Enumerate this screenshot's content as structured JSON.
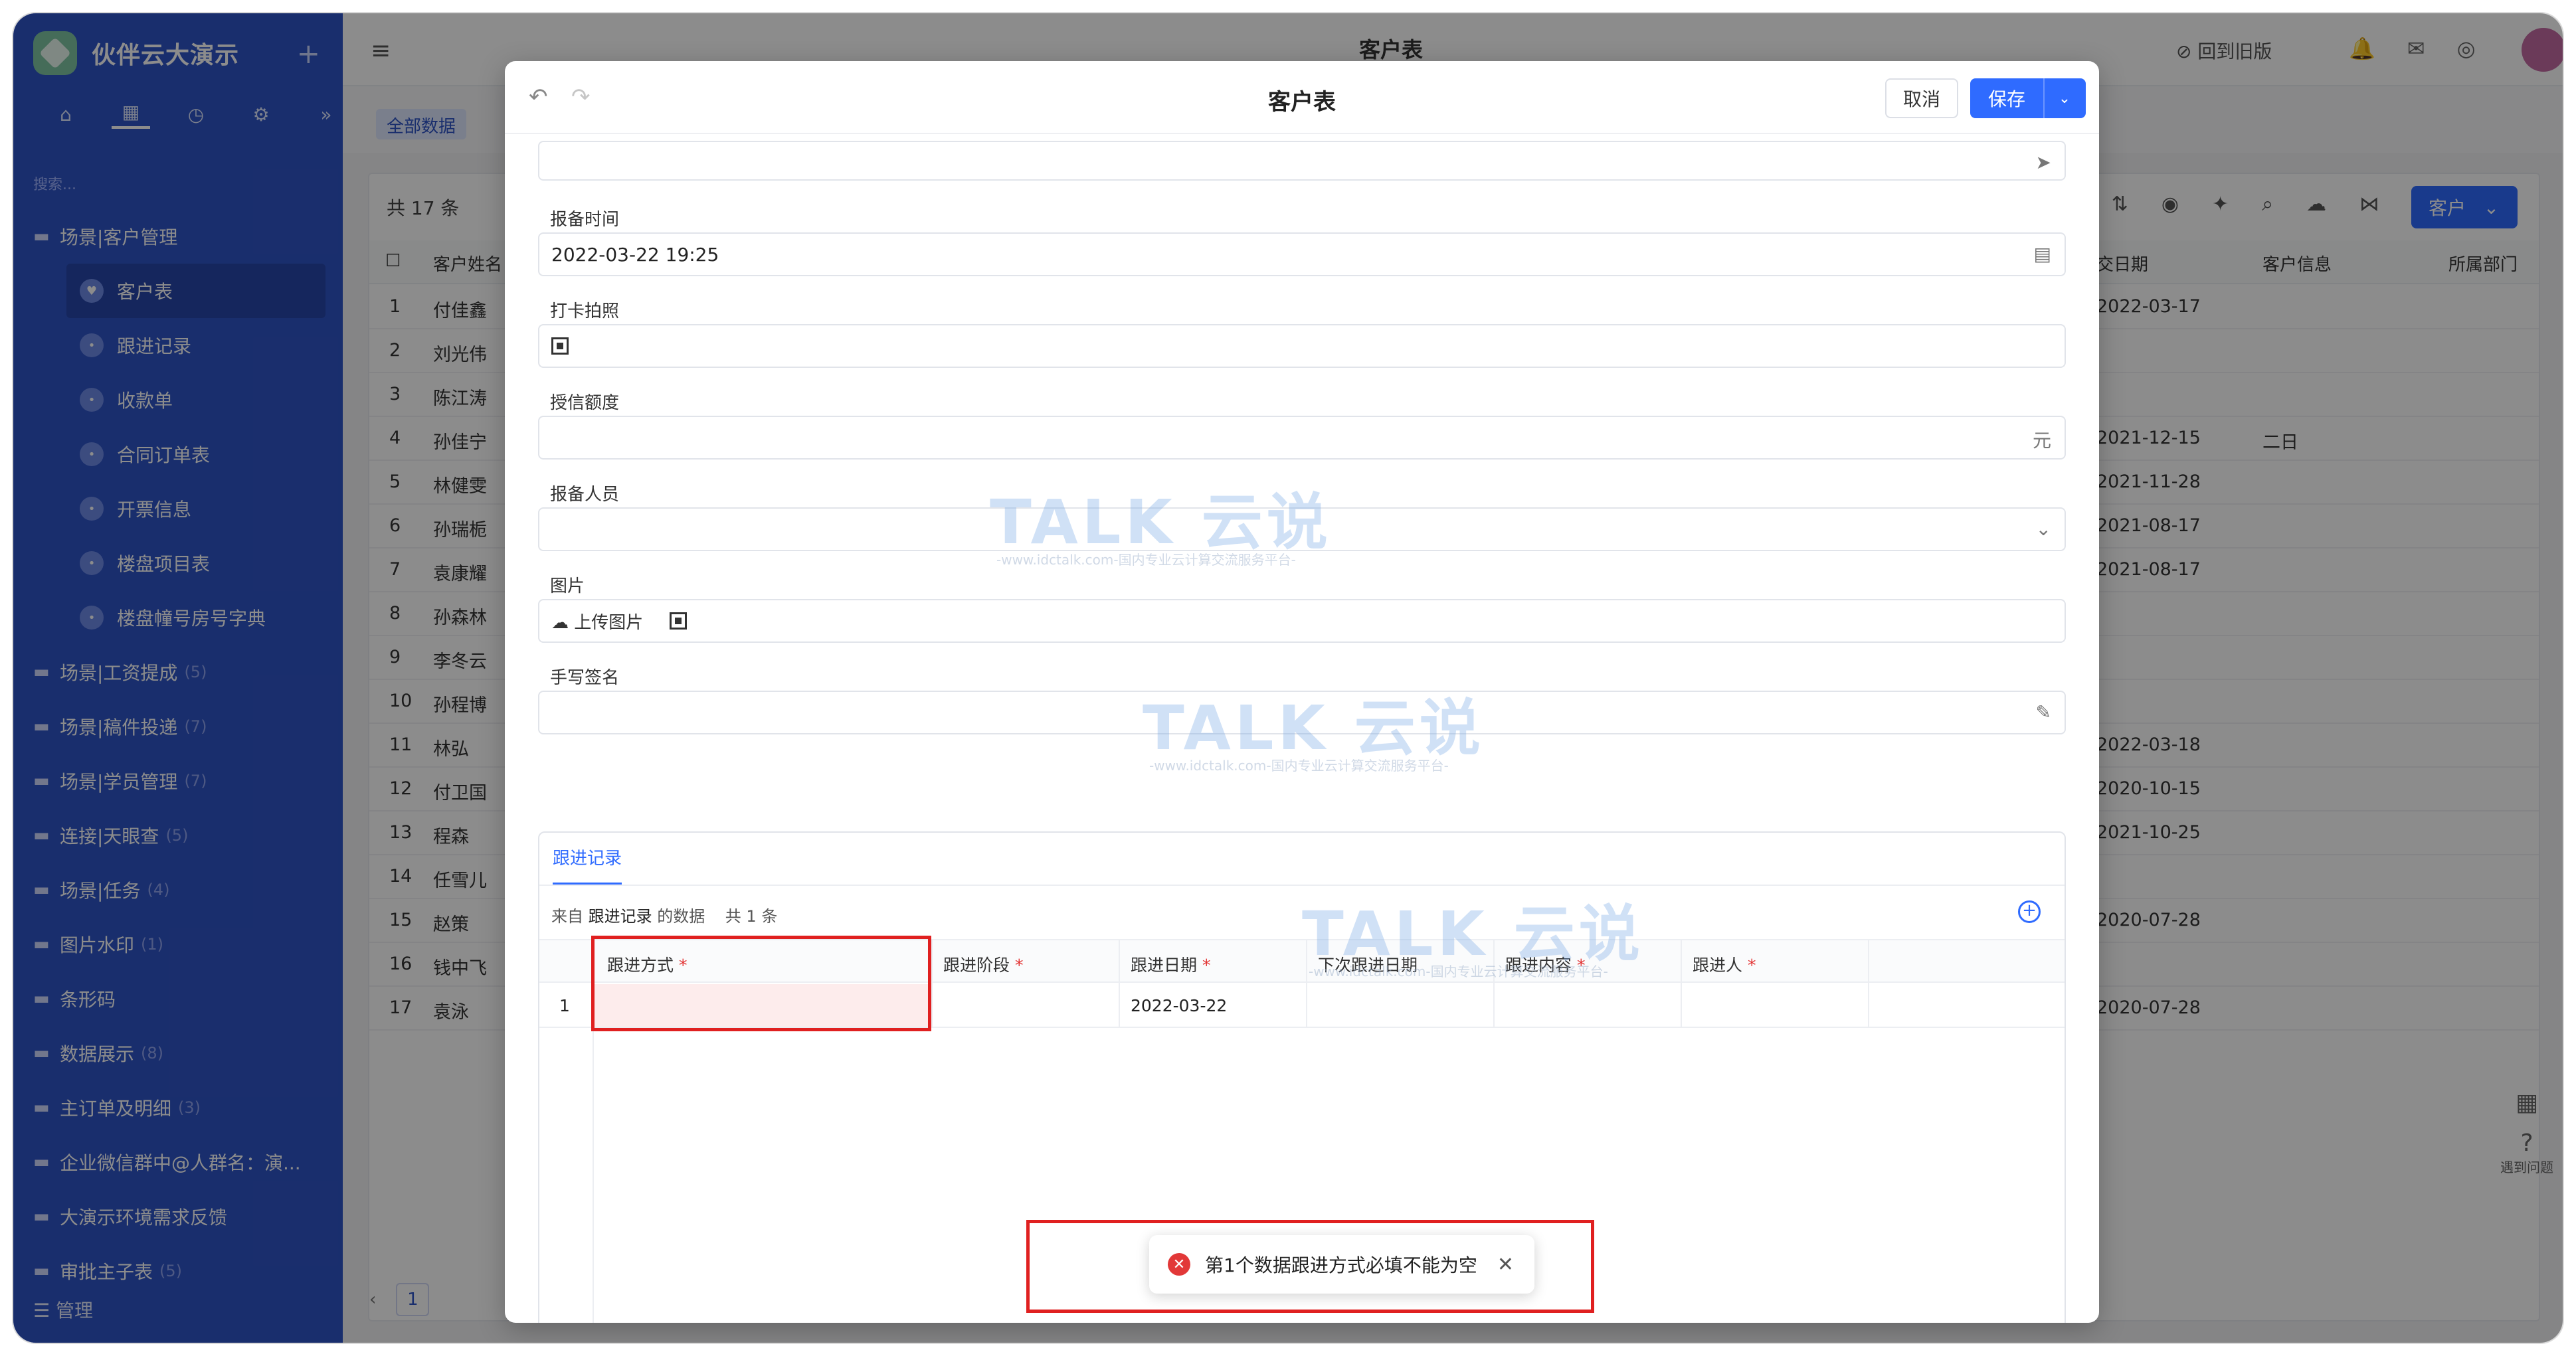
{
  "app": {
    "title": "伙伴云大演示"
  },
  "sidebar": {
    "search_placeholder": "搜索...",
    "items": [
      {
        "label": "场景|客户管理",
        "count": ""
      },
      {
        "label": "客户表",
        "count": "",
        "sub": true,
        "selected": true
      },
      {
        "label": "跟进记录",
        "count": "",
        "sub": true
      },
      {
        "label": "收款单",
        "count": "",
        "sub": true
      },
      {
        "label": "合同订单表",
        "count": "",
        "sub": true
      },
      {
        "label": "开票信息",
        "count": "",
        "sub": true
      },
      {
        "label": "楼盘项目表",
        "count": "",
        "sub": true
      },
      {
        "label": "楼盘幢号房号字典",
        "count": "",
        "sub": true
      },
      {
        "label": "场景|工资提成",
        "count": "(5)"
      },
      {
        "label": "场景|稿件投递",
        "count": "(7)"
      },
      {
        "label": "场景|学员管理",
        "count": "(7)"
      },
      {
        "label": "连接|天眼查",
        "count": "(5)"
      },
      {
        "label": "场景|任务",
        "count": "(4)"
      },
      {
        "label": "图片水印",
        "count": "(1)"
      },
      {
        "label": "条形码",
        "count": ""
      },
      {
        "label": "数据展示",
        "count": "(8)"
      },
      {
        "label": "主订单及明细",
        "count": "(3)"
      },
      {
        "label": "企业微信群中@人群名：演...",
        "count": ""
      },
      {
        "label": "大演示环境需求反馈",
        "count": ""
      },
      {
        "label": "审批主子表",
        "count": "(5)"
      }
    ],
    "footer": "管理"
  },
  "topbar": {
    "page_title": "客户表",
    "old_version": "回到旧版"
  },
  "view": {
    "all_data": "全部数据",
    "count_text": "共 17 条",
    "customer_btn": "客户"
  },
  "grid": {
    "headers": [
      "客户姓名",
      "交日期",
      "客户信息",
      "所属部门"
    ],
    "rows": [
      {
        "n": "1",
        "name": "付佳鑫",
        "date": "2022-03-17",
        "info": ""
      },
      {
        "n": "2",
        "name": "刘光伟",
        "date": "",
        "info": ""
      },
      {
        "n": "3",
        "name": "陈江涛",
        "date": "",
        "info": ""
      },
      {
        "n": "4",
        "name": "孙佳宁",
        "date": "2021-12-15",
        "info": "二日"
      },
      {
        "n": "5",
        "name": "林健雯",
        "date": "2021-11-28",
        "info": ""
      },
      {
        "n": "6",
        "name": "孙瑞栀",
        "date": "2021-08-17",
        "info": ""
      },
      {
        "n": "7",
        "name": "袁康耀",
        "date": "2021-08-17",
        "info": ""
      },
      {
        "n": "8",
        "name": "孙森林",
        "date": "",
        "info": ""
      },
      {
        "n": "9",
        "name": "李冬云",
        "date": "",
        "info": ""
      },
      {
        "n": "10",
        "name": "孙程博",
        "date": "",
        "info": ""
      },
      {
        "n": "11",
        "name": "林弘",
        "date": "2022-03-18",
        "info": ""
      },
      {
        "n": "12",
        "name": "付卫国",
        "date": "2020-10-15",
        "info": ""
      },
      {
        "n": "13",
        "name": "程森",
        "date": "2021-10-25",
        "info": ""
      },
      {
        "n": "14",
        "name": "任雪儿",
        "date": "",
        "info": ""
      },
      {
        "n": "15",
        "name": "赵策",
        "date": "2020-07-28",
        "info": ""
      },
      {
        "n": "16",
        "name": "钱中飞",
        "date": "",
        "info": ""
      },
      {
        "n": "17",
        "name": "袁泳",
        "date": "2020-07-28",
        "info": ""
      }
    ],
    "page": "1"
  },
  "side_float": {
    "help": "遇到问题"
  },
  "modal": {
    "title": "客户表",
    "cancel": "取消",
    "save": "保存",
    "fields": {
      "report_time_label": "报备时间",
      "report_time_value": "2022-03-22 19:25",
      "checkin_photo_label": "打卡拍照",
      "credit_label": "授信额度",
      "credit_suffix": "元",
      "reporter_label": "报备人员",
      "image_label": "图片",
      "upload_label": "上传图片",
      "signature_label": "手写签名"
    },
    "sub_table": {
      "tab": "跟进记录",
      "source_prefix": "来自",
      "source_name": "跟进记录",
      "source_suffix": "的数据",
      "count": "共 1 条",
      "columns": [
        "跟进方式",
        "跟进阶段",
        "跟进日期",
        "下次跟进日期",
        "跟进内容",
        "跟进人"
      ],
      "required": [
        true,
        true,
        true,
        false,
        true,
        true
      ],
      "row": {
        "n": "1",
        "method": "",
        "stage": "",
        "date": "2022-03-22",
        "next": "",
        "content": "",
        "person": ""
      }
    },
    "toast": "第1个数据跟进方式必填不能为空"
  },
  "watermark": {
    "text": "TALK 云说",
    "sub": "-www.idctalk.com-国内专业云计算交流服务平台-"
  },
  "colors": {
    "sidebar": "#2f54c7",
    "primary": "#2f6bff",
    "error": "#e02020"
  }
}
